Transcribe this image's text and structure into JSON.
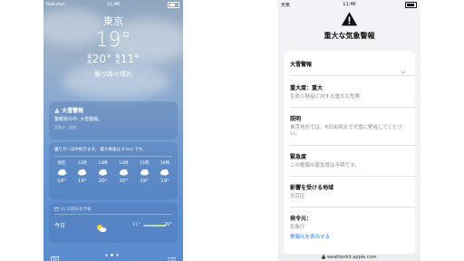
{
  "left": {
    "status": {
      "carrier": "Rakuten",
      "time": "11:46"
    },
    "city": "東京",
    "temperature": "19°",
    "high_label": "最高",
    "high": "20°",
    "low_label": "最低",
    "low": "11°",
    "condition": "曇り時々晴れ",
    "alert": {
      "title": "大雪警報",
      "description": "警報発令中: 大雪警報。",
      "source": "気象庁 · 詳細"
    },
    "hourly": {
      "summary": "曇りが一日中続きます。 最大風速は 8 m/s です。",
      "items": [
        {
          "time": "現在",
          "temp": "19°"
        },
        {
          "time": "12時",
          "temp": "19°"
        },
        {
          "time": "13時",
          "temp": "20°"
        },
        {
          "time": "14時",
          "temp": "20°"
        },
        {
          "time": "15時",
          "temp": "19°"
        },
        {
          "time": "16時",
          "temp": "19°"
        }
      ]
    },
    "forecast": {
      "header": "10 日間天気予報",
      "day": "今日",
      "low": "11°",
      "high": "20°"
    },
    "page_dots": 3
  },
  "right": {
    "status": {
      "carrier": "天気",
      "time": "11:46"
    },
    "title": "重大な気象警報",
    "rows": {
      "alert_name": "大雪警報",
      "severity_label": "重大度：重大",
      "severity_text": "生命と財産に対する重大な危険",
      "description_label": "説明",
      "description_text": "東京地方では、6日未明まで大雪に警戒してください。",
      "urgency_label": "緊急度",
      "urgency_text": "この警報の緊急度は不明です。",
      "area_label": "影響を受ける地域",
      "area_text": "文京区",
      "issuer_label": "発令元：",
      "issuer_text": "気象庁",
      "issuer_link": "警報元を表示する"
    },
    "url": "weatherkit.apple.com"
  },
  "colors": {
    "sky_top": "#8fa6c0",
    "sky_bottom": "#5a8ccf",
    "link_blue": "#2f7bf6",
    "secondary_text": "#8e8e93"
  }
}
